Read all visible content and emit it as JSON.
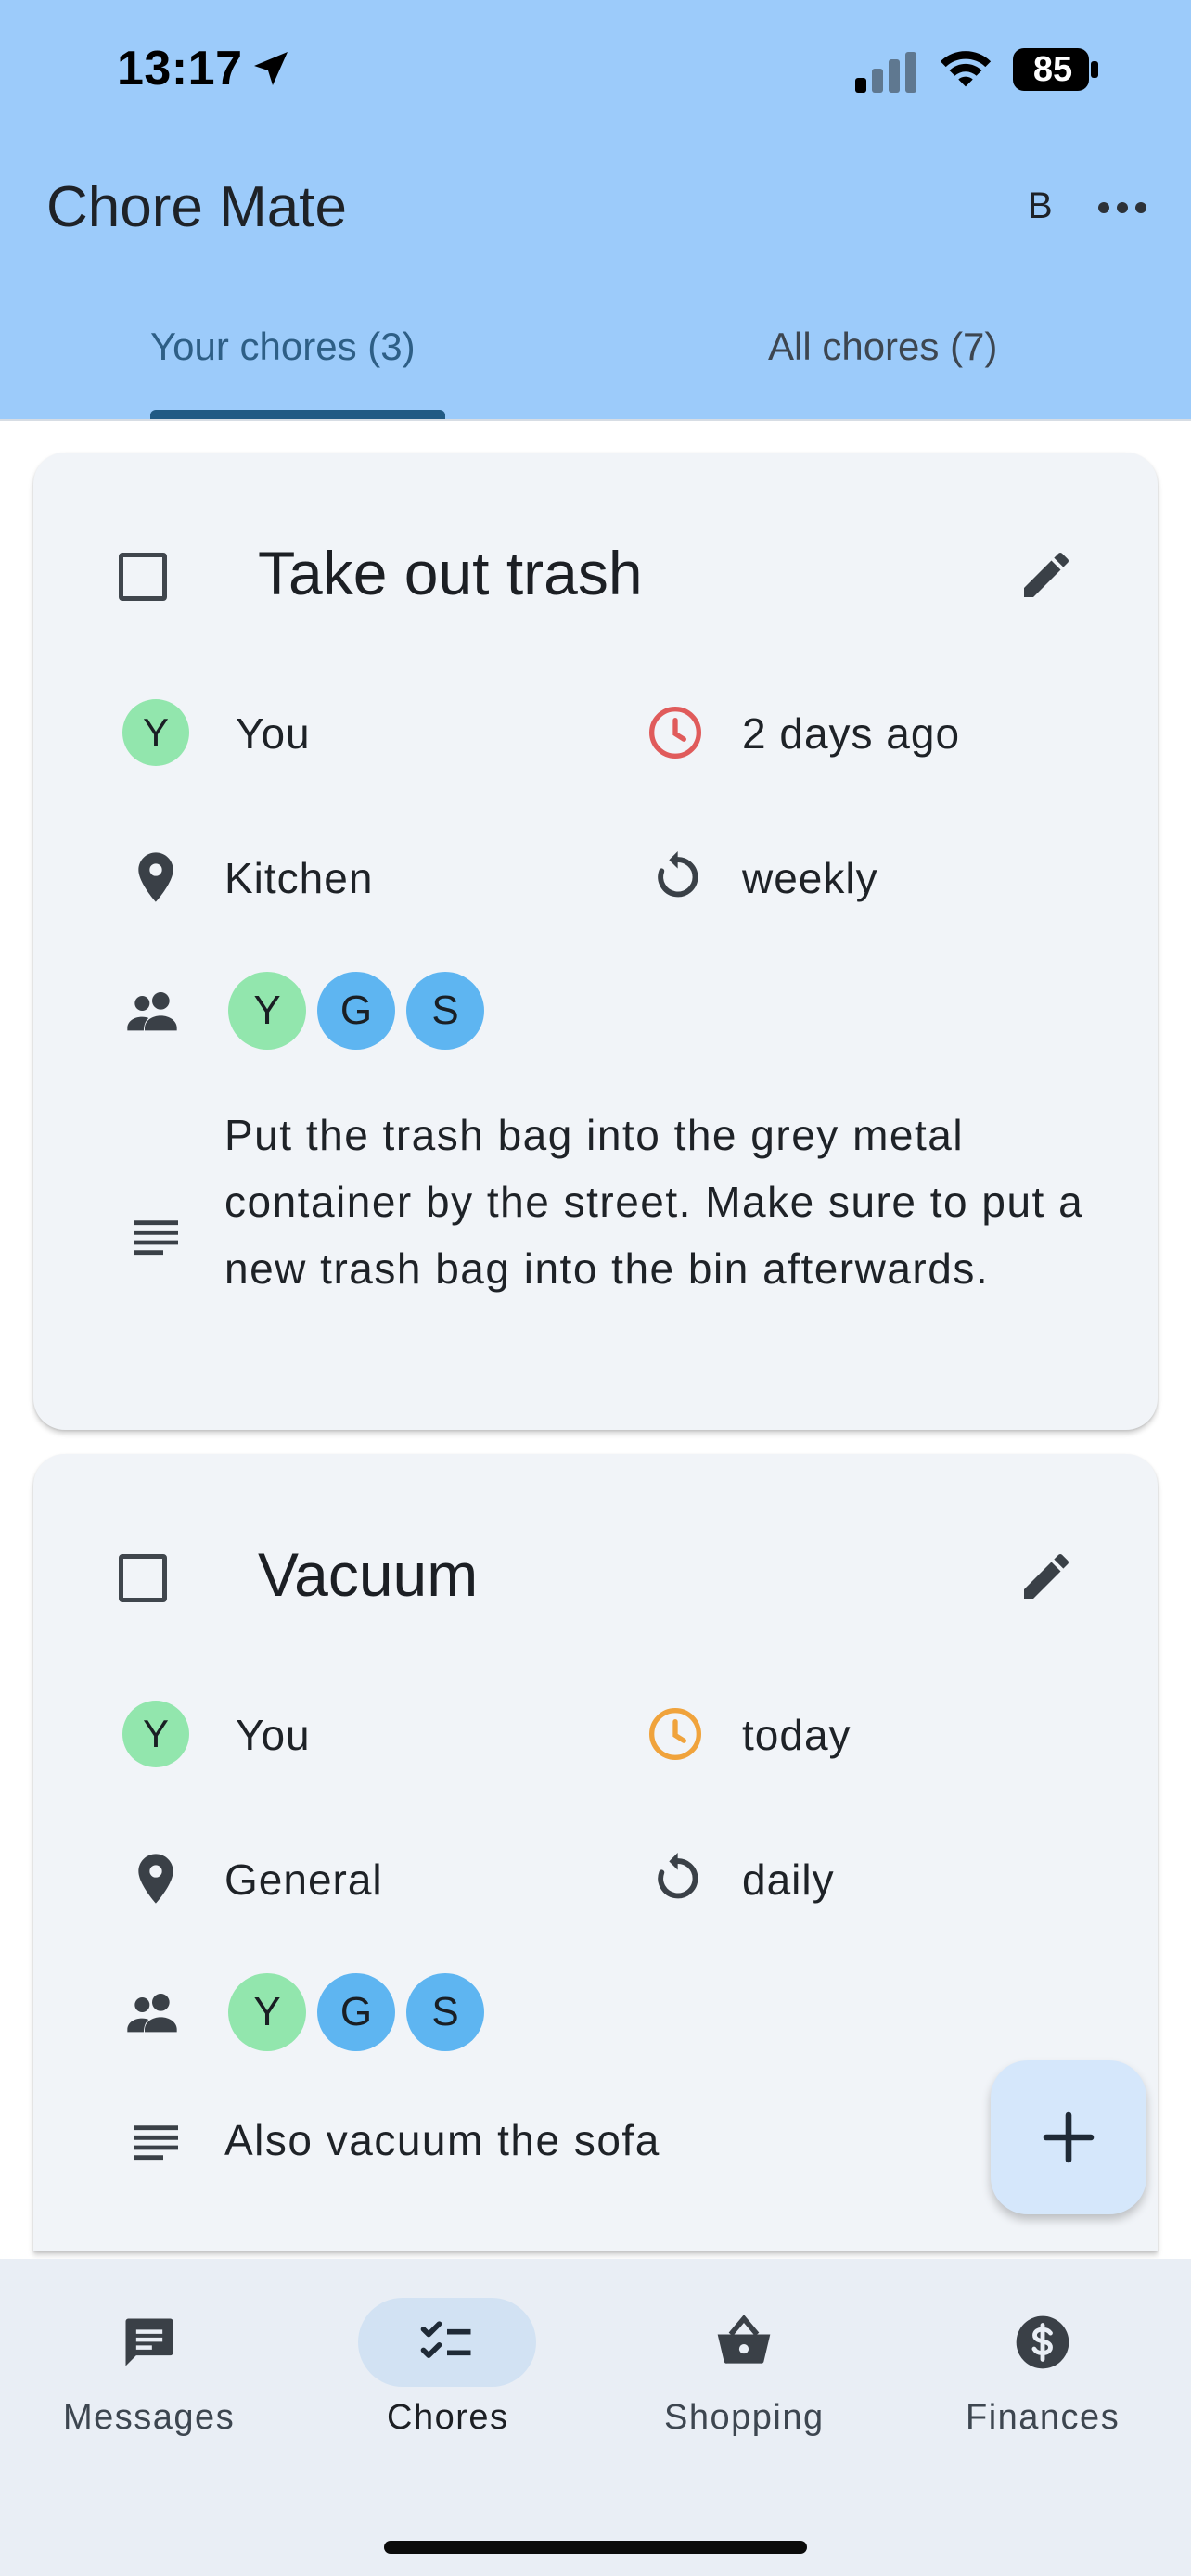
{
  "status_bar": {
    "time": "13:17",
    "battery": "85"
  },
  "app": {
    "title": "Chore Mate",
    "user_initial": "B"
  },
  "tabs": [
    {
      "label": "Your chores (3)",
      "active": true
    },
    {
      "label": "All chores (7)",
      "active": false
    }
  ],
  "chores": [
    {
      "title": "Take out trash",
      "assignee_initial": "Y",
      "assignee": "You",
      "due": "2 days ago",
      "due_color": "#e05b5b",
      "location": "Kitchen",
      "recurrence": "weekly",
      "participants": [
        "Y",
        "G",
        "S"
      ],
      "description": "Put the trash bag into the grey metal container by the street. Make sure to put a new trash bag into the bin afterwards."
    },
    {
      "title": "Vacuum",
      "assignee_initial": "Y",
      "assignee": "You",
      "due": "today",
      "due_color": "#f0a33c",
      "location": "General",
      "recurrence": "daily",
      "participants": [
        "Y",
        "G",
        "S"
      ],
      "description": "Also vacuum the sofa"
    }
  ],
  "nav": [
    {
      "label": "Messages",
      "icon": "message-icon",
      "active": false
    },
    {
      "label": "Chores",
      "icon": "checklist-icon",
      "active": true
    },
    {
      "label": "Shopping",
      "icon": "basket-icon",
      "active": false
    },
    {
      "label": "Finances",
      "icon": "dollar-icon",
      "active": false
    }
  ],
  "colors": {
    "header_bg": "#9ccbfa",
    "card_bg": "#f1f4f8",
    "avatar_green": "#92e6ad",
    "avatar_blue": "#5eb5f1",
    "fab_bg": "#d5e7fb",
    "nav_bg": "#e9eef5"
  }
}
